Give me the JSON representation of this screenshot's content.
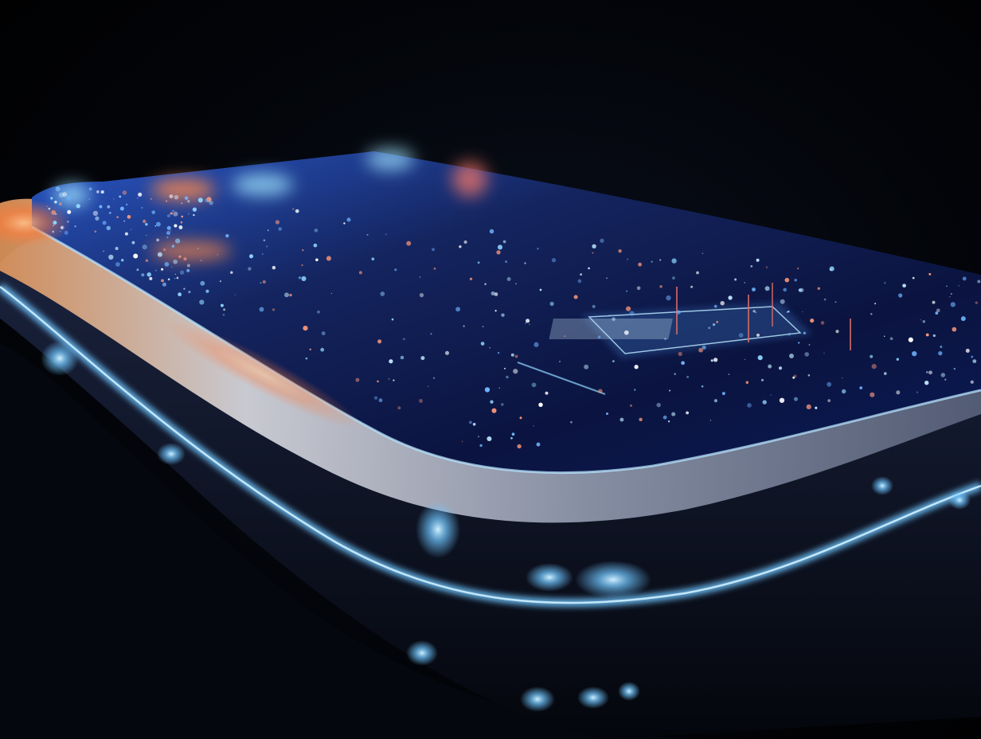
{
  "scene": {
    "subject": "glowing-smartphone",
    "colors": {
      "background": "#000000",
      "screen_deep": "#0a1440",
      "screen_mid": "#1a3a9a",
      "glow_blue": "#6fc6ff",
      "glow_cyan": "#9fe4ff",
      "accent_orange": "#ff8a4a",
      "accent_pink": "#ff6fa8",
      "frame_silver": "#c9ccd6"
    }
  }
}
